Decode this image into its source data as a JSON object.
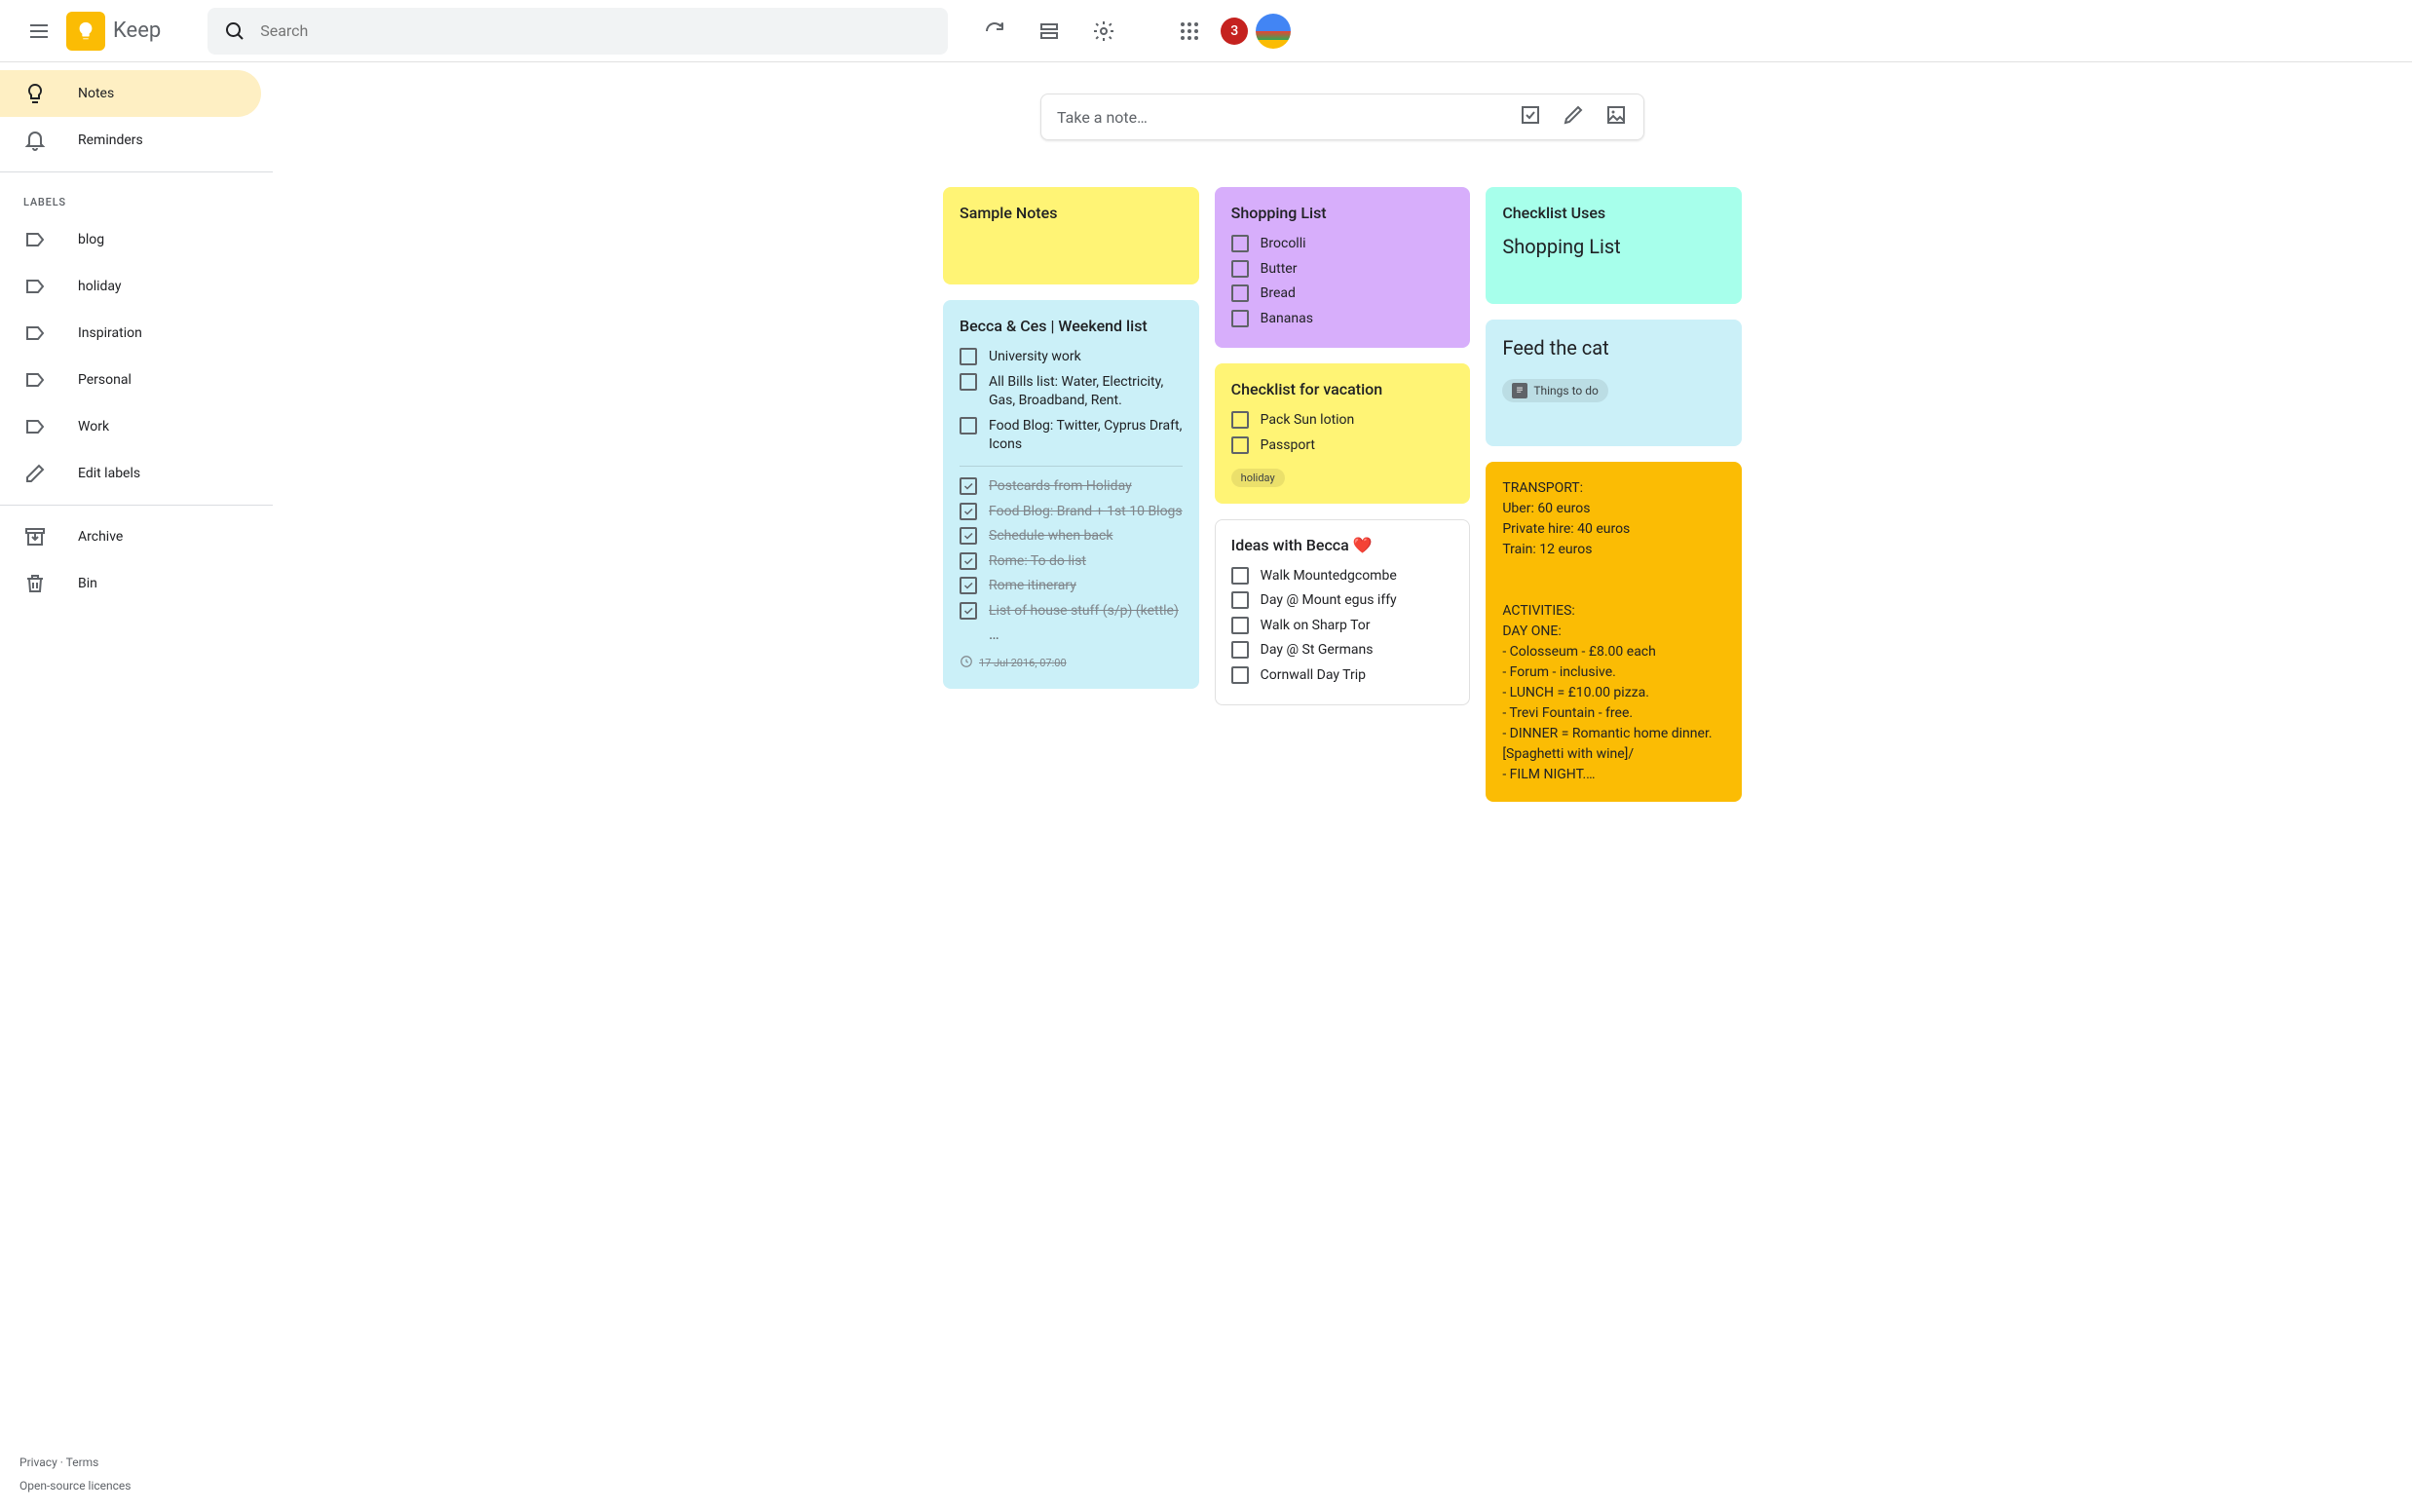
{
  "header": {
    "app_name": "Keep",
    "search_placeholder": "Search",
    "badge_count": "3"
  },
  "sidebar": {
    "notes": "Notes",
    "reminders": "Reminders",
    "labels_header": "LABELS",
    "labels": [
      "blog",
      "holiday",
      "Inspiration",
      "Personal",
      "Work"
    ],
    "edit_labels": "Edit labels",
    "archive": "Archive",
    "bin": "Bin"
  },
  "footer": {
    "privacy": "Privacy",
    "terms": "Terms",
    "licences": "Open-source licences"
  },
  "take_note": {
    "placeholder": "Take a note…"
  },
  "notes": {
    "sample": {
      "title": "Sample Notes"
    },
    "weekend": {
      "title": "Becca & Ces | Weekend list",
      "unchecked": [
        "University work",
        "All Bills list: Water, Electricity, Gas, Broadband, Rent.",
        "Food Blog: Twitter, Cyprus Draft, Icons"
      ],
      "checked": [
        "Postcards from Holiday",
        "Food Blog: Brand + 1st 10 Blogs",
        "Schedule when back",
        "Rome: To do list",
        "Rome itinerary",
        "List of house stuff (s/p) (kettle)"
      ],
      "more": "…",
      "reminder": "17 Jul 2016, 07:00"
    },
    "shopping": {
      "title": "Shopping List",
      "items": [
        "Brocolli",
        "Butter",
        "Bread",
        "Bananas"
      ]
    },
    "vacation": {
      "title": "Checklist for vacation",
      "items": [
        "Pack Sun lotion",
        "Passport"
      ],
      "label": "holiday"
    },
    "ideas": {
      "title": "Ideas with Becca ❤️",
      "items": [
        "Walk Mountedgcombe",
        "Day @ Mount egus iffy",
        "Walk on Sharp Tor",
        "Day @ St Germans",
        "Cornwall Day Trip"
      ]
    },
    "checklist_uses": {
      "title": "Checklist Uses",
      "body": "Shopping List"
    },
    "feed_cat": {
      "title": "Feed the cat",
      "chip": "Things to do"
    },
    "transport": {
      "body": "TRANSPORT:\nUber: 60 euros\nPrivate hire: 40 euros\nTrain: 12 euros\n\n\nACTIVITIES:\nDAY ONE:\n- Colosseum - £8.00 each\n- Forum - inclusive.\n- LUNCH = £10.00 pizza.\n- Trevi Fountain - free.\n- DINNER = Romantic home dinner. [Spaghetti with wine]/\n- FILM NIGHT.…"
    }
  }
}
